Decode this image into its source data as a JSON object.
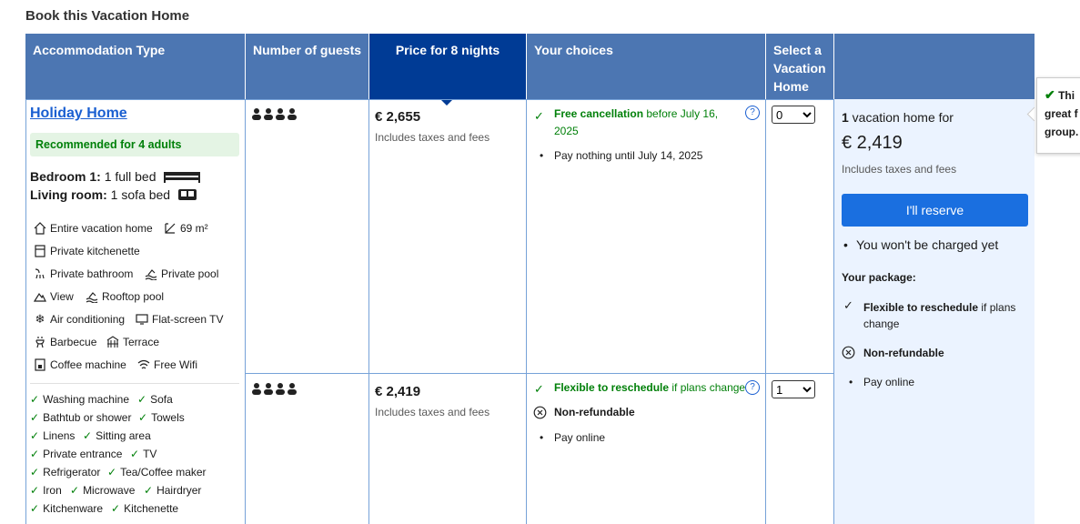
{
  "section_title": "Book this Vacation Home",
  "headers": {
    "accommodation_type": "Accommodation Type",
    "guests": "Number of guests",
    "price": "Price for 8 nights",
    "choices": "Your choices",
    "select": "Select a Vacation Home"
  },
  "room": {
    "name": "Holiday Home",
    "recommended": "Recommended for 4 adults",
    "beds": [
      {
        "label": "Bedroom 1:",
        "value": "1 full bed"
      },
      {
        "label": "Living room:",
        "value": "1 sofa bed"
      }
    ],
    "facilities": [
      {
        "icon": "house-icon",
        "text": "Entire vacation home"
      },
      {
        "icon": "area-icon",
        "text": "69 m²"
      },
      {
        "icon": "kitchenette-icon",
        "text": "Private kitchenette"
      },
      {
        "icon": "bathroom-icon",
        "text": "Private bathroom"
      },
      {
        "icon": "pool-icon",
        "text": "Private pool"
      },
      {
        "icon": "mountain-icon",
        "text": "View"
      },
      {
        "icon": "rooftop-pool-icon",
        "text": "Rooftop pool"
      },
      {
        "icon": "snowflake-icon",
        "text": "Air conditioning"
      },
      {
        "icon": "tv-icon",
        "text": "Flat-screen TV"
      },
      {
        "icon": "barbecue-icon",
        "text": "Barbecue"
      },
      {
        "icon": "terrace-icon",
        "text": "Terrace"
      },
      {
        "icon": "coffee-machine-icon",
        "text": "Coffee machine"
      },
      {
        "icon": "wifi-icon",
        "text": "Free Wifi"
      }
    ],
    "amenities": [
      "Washing machine",
      "Sofa",
      "Bathtub or shower",
      "Towels",
      "Linens",
      "Sitting area",
      "Private entrance",
      "TV",
      "Refrigerator",
      "Tea/Coffee maker",
      "Iron",
      "Microwave",
      "Hairdryer",
      "Kitchenware",
      "Kitchenette"
    ]
  },
  "options": [
    {
      "price": "€ 2,655",
      "taxes": "Includes taxes and fees",
      "choice_bold": "Free cancellation",
      "choice_rest": " before July 16, 2025",
      "bullets": [
        "Pay nothing until July 14, 2025"
      ],
      "select_value": "0"
    },
    {
      "price": "€ 2,419",
      "taxes": "Includes taxes and fees",
      "choice_bold": "Flexible to reschedule",
      "choice_rest": " if plans change",
      "nonref": "Non-refundable",
      "bullets": [
        "Pay online"
      ],
      "select_value": "1"
    }
  ],
  "summary": {
    "count": "1",
    "count_rest": " vacation home for",
    "price": "€ 2,419",
    "taxes": "Includes taxes and fees",
    "reserve": "I'll reserve",
    "no_charge": "You won't be charged yet",
    "package_title": "Your package:",
    "pkg_flex_bold": "Flexible to reschedule",
    "pkg_flex_rest": " if plans change",
    "pkg_nonref": "Non-refundable",
    "pkg_pay": "Pay online"
  },
  "tooltip": {
    "line1": "Thi",
    "line2": "great f",
    "line3": "group."
  },
  "colors": {
    "header": "#4c76b2",
    "header_selected": "#003b95",
    "green": "#008009",
    "link": "#1a5fd1",
    "summary_bg": "#ebf3ff"
  }
}
